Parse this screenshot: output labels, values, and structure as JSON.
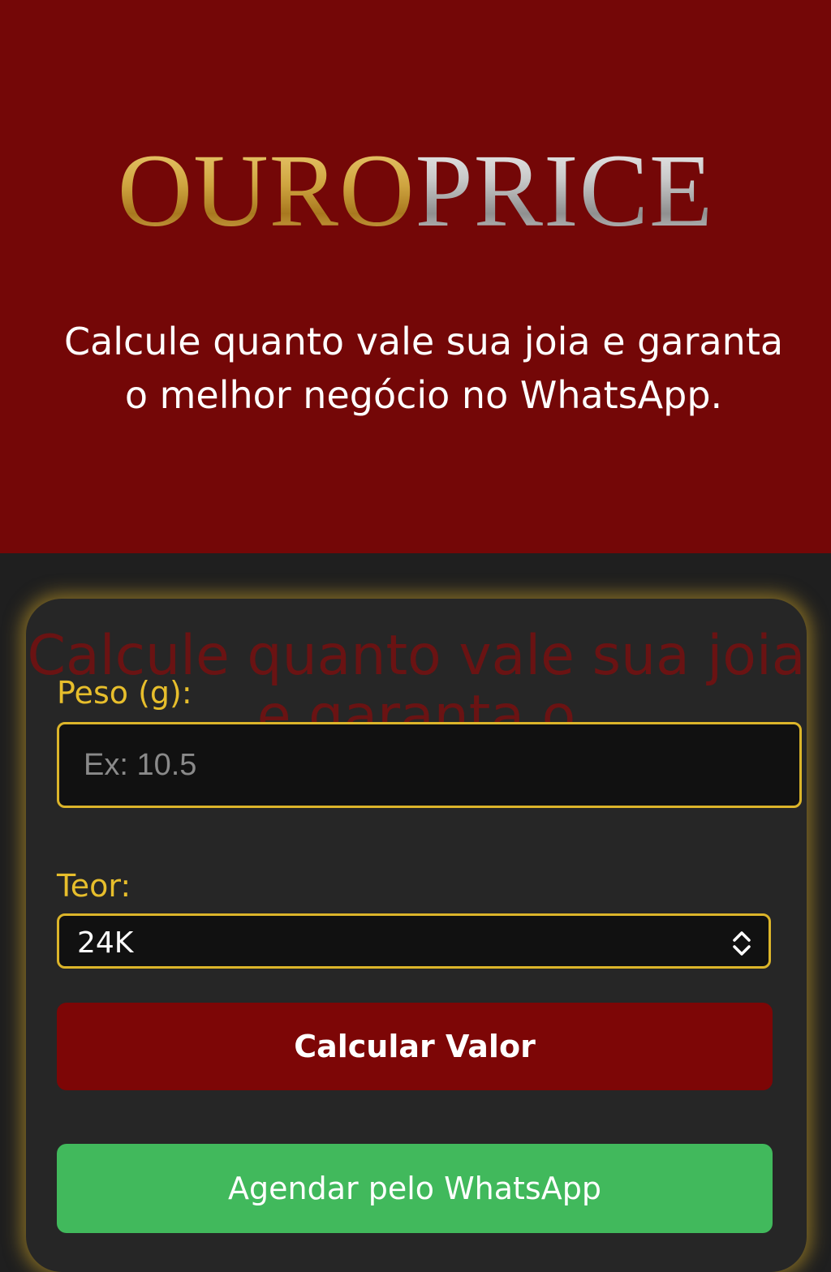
{
  "header": {
    "logo_gold": "OURO",
    "logo_silver": "PRICE",
    "tagline": "Calcule quanto vale sua joia e garanta o melhor negócio no WhatsApp."
  },
  "form": {
    "ghost_text": "Calcule quanto vale sua joia e garanta o",
    "weight_label": "Peso (g):",
    "weight_placeholder": "Ex: 10.5",
    "weight_value": "",
    "purity_label": "Teor:",
    "purity_selected": "24K",
    "calculate_label": "Calcular Valor",
    "whatsapp_label": "Agendar pelo WhatsApp"
  },
  "colors": {
    "hero_bg": "#740707",
    "gold_accent": "#e7be2c",
    "calculate_bg": "#7d0606",
    "whatsapp_bg": "#41b95c"
  }
}
